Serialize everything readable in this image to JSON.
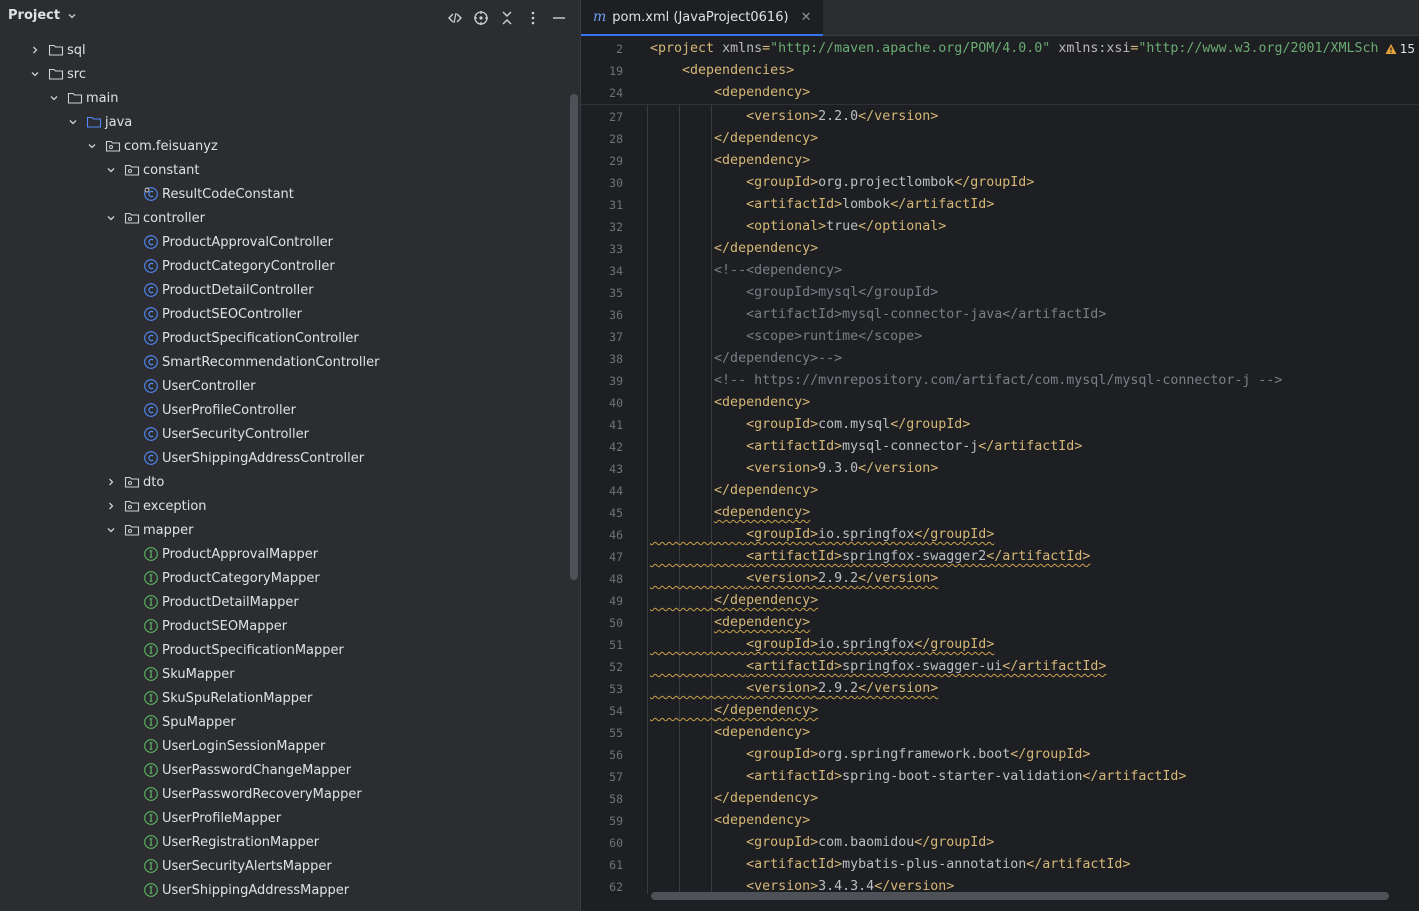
{
  "panel": {
    "title": "Project",
    "tree": [
      {
        "label": "sql",
        "indent": 0,
        "arrow": "right",
        "icon": "folder-icon"
      },
      {
        "label": "src",
        "indent": 0,
        "arrow": "down",
        "icon": "folder-icon"
      },
      {
        "label": "main",
        "indent": 1,
        "arrow": "down",
        "icon": "folder-icon"
      },
      {
        "label": "java",
        "indent": 2,
        "arrow": "down",
        "icon": "source-folder-icon"
      },
      {
        "label": "com.feisuanyz",
        "indent": 3,
        "arrow": "down",
        "icon": "package-icon"
      },
      {
        "label": "constant",
        "indent": 4,
        "arrow": "down",
        "icon": "package-icon"
      },
      {
        "label": "ResultCodeConstant",
        "indent": 5,
        "arrow": "none",
        "icon": "final-class-icon"
      },
      {
        "label": "controller",
        "indent": 4,
        "arrow": "down",
        "icon": "package-icon"
      },
      {
        "label": "ProductApprovalController",
        "indent": 5,
        "arrow": "none",
        "icon": "class-icon"
      },
      {
        "label": "ProductCategoryController",
        "indent": 5,
        "arrow": "none",
        "icon": "class-icon"
      },
      {
        "label": "ProductDetailController",
        "indent": 5,
        "arrow": "none",
        "icon": "class-icon"
      },
      {
        "label": "ProductSEOController",
        "indent": 5,
        "arrow": "none",
        "icon": "class-icon"
      },
      {
        "label": "ProductSpecificationController",
        "indent": 5,
        "arrow": "none",
        "icon": "class-icon"
      },
      {
        "label": "SmartRecommendationController",
        "indent": 5,
        "arrow": "none",
        "icon": "class-icon"
      },
      {
        "label": "UserController",
        "indent": 5,
        "arrow": "none",
        "icon": "class-icon"
      },
      {
        "label": "UserProfileController",
        "indent": 5,
        "arrow": "none",
        "icon": "class-icon"
      },
      {
        "label": "UserSecurityController",
        "indent": 5,
        "arrow": "none",
        "icon": "class-icon"
      },
      {
        "label": "UserShippingAddressController",
        "indent": 5,
        "arrow": "none",
        "icon": "class-icon"
      },
      {
        "label": "dto",
        "indent": 4,
        "arrow": "right",
        "icon": "package-icon"
      },
      {
        "label": "exception",
        "indent": 4,
        "arrow": "right",
        "icon": "package-icon"
      },
      {
        "label": "mapper",
        "indent": 4,
        "arrow": "down",
        "icon": "package-icon"
      },
      {
        "label": "ProductApprovalMapper",
        "indent": 5,
        "arrow": "none",
        "icon": "interface-icon"
      },
      {
        "label": "ProductCategoryMapper",
        "indent": 5,
        "arrow": "none",
        "icon": "interface-icon"
      },
      {
        "label": "ProductDetailMapper",
        "indent": 5,
        "arrow": "none",
        "icon": "interface-icon"
      },
      {
        "label": "ProductSEOMapper",
        "indent": 5,
        "arrow": "none",
        "icon": "interface-icon"
      },
      {
        "label": "ProductSpecificationMapper",
        "indent": 5,
        "arrow": "none",
        "icon": "interface-icon"
      },
      {
        "label": "SkuMapper",
        "indent": 5,
        "arrow": "none",
        "icon": "interface-icon"
      },
      {
        "label": "SkuSpuRelationMapper",
        "indent": 5,
        "arrow": "none",
        "icon": "interface-icon"
      },
      {
        "label": "SpuMapper",
        "indent": 5,
        "arrow": "none",
        "icon": "interface-icon"
      },
      {
        "label": "UserLoginSessionMapper",
        "indent": 5,
        "arrow": "none",
        "icon": "interface-icon"
      },
      {
        "label": "UserPasswordChangeMapper",
        "indent": 5,
        "arrow": "none",
        "icon": "interface-icon"
      },
      {
        "label": "UserPasswordRecoveryMapper",
        "indent": 5,
        "arrow": "none",
        "icon": "interface-icon"
      },
      {
        "label": "UserProfileMapper",
        "indent": 5,
        "arrow": "none",
        "icon": "interface-icon"
      },
      {
        "label": "UserRegistrationMapper",
        "indent": 5,
        "arrow": "none",
        "icon": "interface-icon"
      },
      {
        "label": "UserSecurityAlertsMapper",
        "indent": 5,
        "arrow": "none",
        "icon": "interface-icon"
      },
      {
        "label": "UserShippingAddressMapper",
        "indent": 5,
        "arrow": "none",
        "icon": "interface-icon"
      }
    ]
  },
  "editor": {
    "tab_label": "pom.xml (JavaProject0616)",
    "tab_icon": "maven-m-icon",
    "warning_count": "15",
    "lines": [
      {
        "n": "2",
        "depth": 0,
        "sticky": true,
        "tokens": [
          [
            "tag",
            "<project "
          ],
          [
            "attr",
            "xmlns"
          ],
          [
            "tag",
            "="
          ],
          [
            "str",
            "\"http://maven.apache.org/POM/4.0.0\""
          ],
          [
            "attr",
            " xmlns:xsi"
          ],
          [
            "tag",
            "="
          ],
          [
            "str",
            "\"http://www.w3.org/2001/XMLSch"
          ]
        ]
      },
      {
        "n": "19",
        "depth": 1,
        "sticky": true,
        "tokens": [
          [
            "tag",
            "<dependencies>"
          ]
        ]
      },
      {
        "n": "24",
        "depth": 2,
        "sticky": true,
        "tokens": [
          [
            "tag",
            "<dependency>"
          ]
        ]
      },
      {
        "n": "27",
        "depth": 3,
        "tokens": [
          [
            "tag",
            "<version>"
          ],
          [
            "txt",
            "2.2.0"
          ],
          [
            "tag",
            "</version>"
          ]
        ]
      },
      {
        "n": "28",
        "depth": 2,
        "tokens": [
          [
            "tag",
            "</dependency>"
          ]
        ]
      },
      {
        "n": "29",
        "depth": 2,
        "tokens": [
          [
            "tag",
            "<dependency>"
          ]
        ]
      },
      {
        "n": "30",
        "depth": 3,
        "tokens": [
          [
            "tag",
            "<groupId>"
          ],
          [
            "txt",
            "org.projectlombok"
          ],
          [
            "tag",
            "</groupId>"
          ]
        ]
      },
      {
        "n": "31",
        "depth": 3,
        "tokens": [
          [
            "tag",
            "<artifactId>"
          ],
          [
            "txt",
            "lombok"
          ],
          [
            "tag",
            "</artifactId>"
          ]
        ]
      },
      {
        "n": "32",
        "depth": 3,
        "tokens": [
          [
            "tag",
            "<optional>"
          ],
          [
            "txt",
            "true"
          ],
          [
            "tag",
            "</optional>"
          ]
        ]
      },
      {
        "n": "33",
        "depth": 2,
        "tokens": [
          [
            "tag",
            "</dependency>"
          ]
        ]
      },
      {
        "n": "34",
        "depth": 2,
        "tokens": [
          [
            "cmt",
            "<!--<dependency>"
          ]
        ]
      },
      {
        "n": "35",
        "depth": 3,
        "tokens": [
          [
            "cmt",
            "<groupId>mysql</groupId>"
          ]
        ]
      },
      {
        "n": "36",
        "depth": 3,
        "tokens": [
          [
            "cmt",
            "<artifactId>mysql-connector-java</artifactId>"
          ]
        ]
      },
      {
        "n": "37",
        "depth": 3,
        "tokens": [
          [
            "cmt",
            "<scope>runtime</scope>"
          ]
        ]
      },
      {
        "n": "38",
        "depth": 2,
        "tokens": [
          [
            "cmt",
            "</dependency>-->"
          ]
        ]
      },
      {
        "n": "39",
        "depth": 2,
        "tokens": [
          [
            "cmt",
            "<!-- https://mvnrepository.com/artifact/com.mysql/mysql-connector-j -->"
          ]
        ]
      },
      {
        "n": "40",
        "depth": 2,
        "tokens": [
          [
            "tag",
            "<dependency>"
          ]
        ]
      },
      {
        "n": "41",
        "depth": 3,
        "tokens": [
          [
            "tag",
            "<groupId>"
          ],
          [
            "txt",
            "com.mysql"
          ],
          [
            "tag",
            "</groupId>"
          ]
        ]
      },
      {
        "n": "42",
        "depth": 3,
        "tokens": [
          [
            "tag",
            "<artifactId>"
          ],
          [
            "txt",
            "mysql-connector-j"
          ],
          [
            "tag",
            "</artifactId>"
          ]
        ]
      },
      {
        "n": "43",
        "depth": 3,
        "tokens": [
          [
            "tag",
            "<version>"
          ],
          [
            "txt",
            "9.3.0"
          ],
          [
            "tag",
            "</version>"
          ]
        ]
      },
      {
        "n": "44",
        "depth": 2,
        "tokens": [
          [
            "tag",
            "</dependency>"
          ]
        ]
      },
      {
        "n": "45",
        "depth": 2,
        "wavy": "tag",
        "tokens": [
          [
            "tag",
            "<dependency>"
          ]
        ]
      },
      {
        "n": "46",
        "depth": 3,
        "wavy": "all",
        "tokens": [
          [
            "tag",
            "<groupId>"
          ],
          [
            "txt",
            "io.springfox"
          ],
          [
            "tag",
            "</groupId>"
          ]
        ]
      },
      {
        "n": "47",
        "depth": 3,
        "wavy": "all",
        "tokens": [
          [
            "tag",
            "<artifactId>"
          ],
          [
            "txt",
            "springfox-swagger2"
          ],
          [
            "tag",
            "</artifactId>"
          ]
        ]
      },
      {
        "n": "48",
        "depth": 3,
        "wavy": "all",
        "tokens": [
          [
            "tag",
            "<version>"
          ],
          [
            "txt",
            "2.9.2"
          ],
          [
            "tag",
            "</version>"
          ]
        ]
      },
      {
        "n": "49",
        "depth": 2,
        "wavy": "all",
        "tokens": [
          [
            "tag",
            "</dependency>"
          ]
        ]
      },
      {
        "n": "50",
        "depth": 2,
        "wavy": "tag",
        "tokens": [
          [
            "tag",
            "<dependency>"
          ]
        ]
      },
      {
        "n": "51",
        "depth": 3,
        "wavy": "all",
        "tokens": [
          [
            "tag",
            "<groupId>"
          ],
          [
            "txt",
            "io.springfox"
          ],
          [
            "tag",
            "</groupId>"
          ]
        ]
      },
      {
        "n": "52",
        "depth": 3,
        "wavy": "all",
        "tokens": [
          [
            "tag",
            "<artifactId>"
          ],
          [
            "txt",
            "springfox-swagger-ui"
          ],
          [
            "tag",
            "</artifactId>"
          ]
        ]
      },
      {
        "n": "53",
        "depth": 3,
        "wavy": "all",
        "tokens": [
          [
            "tag",
            "<version>"
          ],
          [
            "txt",
            "2.9.2"
          ],
          [
            "tag",
            "</version>"
          ]
        ]
      },
      {
        "n": "54",
        "depth": 2,
        "wavy": "all",
        "tokens": [
          [
            "tag",
            "</dependency>"
          ]
        ]
      },
      {
        "n": "55",
        "depth": 2,
        "tokens": [
          [
            "tag",
            "<dependency>"
          ]
        ]
      },
      {
        "n": "56",
        "depth": 3,
        "tokens": [
          [
            "tag",
            "<groupId>"
          ],
          [
            "txt",
            "org.springframework.boot"
          ],
          [
            "tag",
            "</groupId>"
          ]
        ]
      },
      {
        "n": "57",
        "depth": 3,
        "tokens": [
          [
            "tag",
            "<artifactId>"
          ],
          [
            "txt",
            "spring-boot-starter-validation"
          ],
          [
            "tag",
            "</artifactId>"
          ]
        ]
      },
      {
        "n": "58",
        "depth": 2,
        "tokens": [
          [
            "tag",
            "</dependency>"
          ]
        ]
      },
      {
        "n": "59",
        "depth": 2,
        "tokens": [
          [
            "tag",
            "<dependency>"
          ]
        ]
      },
      {
        "n": "60",
        "depth": 3,
        "tokens": [
          [
            "tag",
            "<groupId>"
          ],
          [
            "txt",
            "com.baomidou"
          ],
          [
            "tag",
            "</groupId>"
          ]
        ]
      },
      {
        "n": "61",
        "depth": 3,
        "tokens": [
          [
            "tag",
            "<artifactId>"
          ],
          [
            "txt",
            "mybatis-plus-annotation"
          ],
          [
            "tag",
            "</artifactId>"
          ]
        ]
      },
      {
        "n": "62",
        "depth": 3,
        "tokens": [
          [
            "tag",
            "<version>"
          ],
          [
            "txt",
            "3.4.3.4"
          ],
          [
            "tag",
            "</version>"
          ]
        ]
      }
    ]
  },
  "colors": {
    "panel_bg": "#2b2d30",
    "editor_bg": "#1e1f22",
    "xml_tag": "#d5b778",
    "xml_string": "#6aab73",
    "comment": "#7a7e85",
    "accent": "#3574f0",
    "warning": "#e3a33a"
  }
}
